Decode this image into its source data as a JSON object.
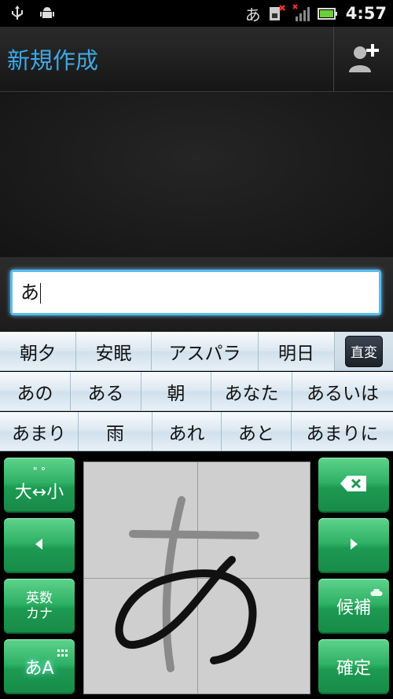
{
  "status_bar": {
    "ime_indicator": "あ",
    "time": "4:57",
    "icons": [
      "usb-icon",
      "android-debug-icon",
      "sim-error-icon",
      "signal-icon",
      "battery-icon"
    ]
  },
  "header": {
    "title": "新規作成",
    "add_contact_icon": "add-contact-icon"
  },
  "compose": {
    "input_value": "あ"
  },
  "candidates": {
    "row1": [
      "朝夕",
      "安眠",
      "アスパラ",
      "明日"
    ],
    "convert_label": "直変",
    "row2": [
      "あの",
      "ある",
      "朝",
      "あなた",
      "あるいは"
    ],
    "row3": [
      "あまり",
      "雨",
      "あれ",
      "あと",
      "あまりに"
    ]
  },
  "keyboard": {
    "case_key": "大↔小",
    "case_key_marks": "\"   °",
    "alnum_key_line1": "英数",
    "alnum_key_line2": "カナ",
    "mode_key": "あA",
    "candidates_key": "候補",
    "confirm_key": "確定",
    "left_icon": "arrow-left-icon",
    "right_icon": "arrow-right-icon",
    "backspace_icon": "backspace-icon"
  },
  "colors": {
    "title": "#3ea8e6",
    "green_key": "#2fb166",
    "input_border": "#5bbcf0"
  }
}
